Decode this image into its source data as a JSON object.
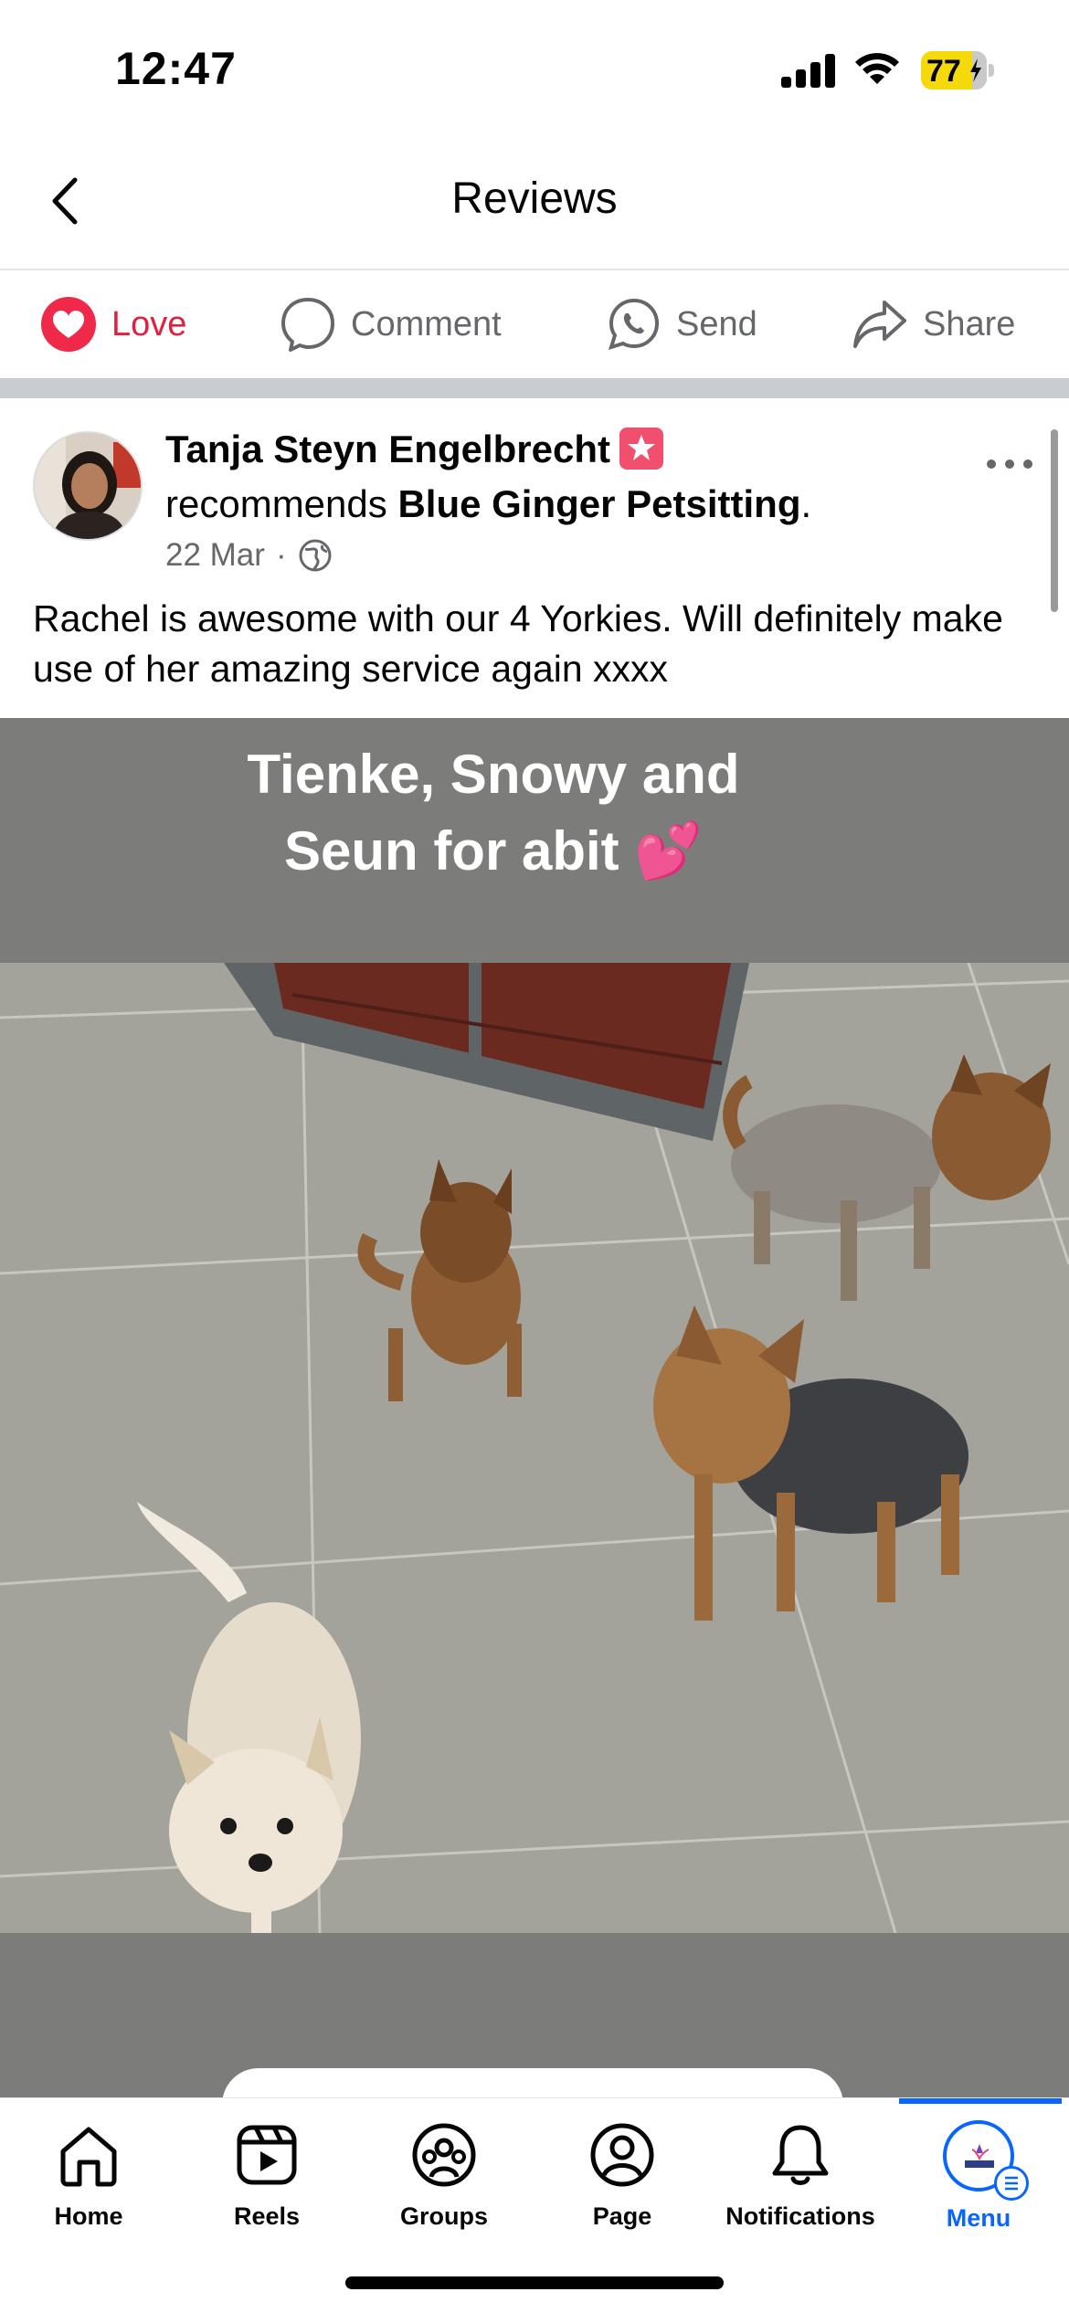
{
  "status_bar": {
    "time": "12:47",
    "battery_level": "77",
    "battery_color": "#f5d90a",
    "charging": true
  },
  "header": {
    "title": "Reviews",
    "back_icon": "chevron-left-icon"
  },
  "actions": {
    "love_label": "Love",
    "comment_label": "Comment",
    "send_label": "Send",
    "share_label": "Share",
    "love_color": "#e41e3f"
  },
  "post": {
    "author": "Tanja Steyn Engelbrecht",
    "recommends_prefix": "recommends",
    "page_name": "Blue Ginger Petsitting",
    "recommends_suffix": ".",
    "date": "22 Mar",
    "meta_separator": "·",
    "privacy_icon": "globe-icon",
    "body": "Rachel is awesome with our 4 Yorkies. Will definitely make use of her amazing service again xxxx",
    "photo_caption_line1": "Tienke, Snowy and",
    "photo_caption_line2": "Seun for abit 💕"
  },
  "bottom_nav": {
    "items": [
      {
        "label": "Home",
        "icon": "home-icon"
      },
      {
        "label": "Reels",
        "icon": "reels-icon"
      },
      {
        "label": "Groups",
        "icon": "groups-icon"
      },
      {
        "label": "Page",
        "icon": "page-icon"
      },
      {
        "label": "Notifications",
        "icon": "bell-icon"
      },
      {
        "label": "Menu",
        "icon": "menu-avatar-icon"
      }
    ],
    "active": "Menu",
    "active_color": "#0866ff"
  }
}
